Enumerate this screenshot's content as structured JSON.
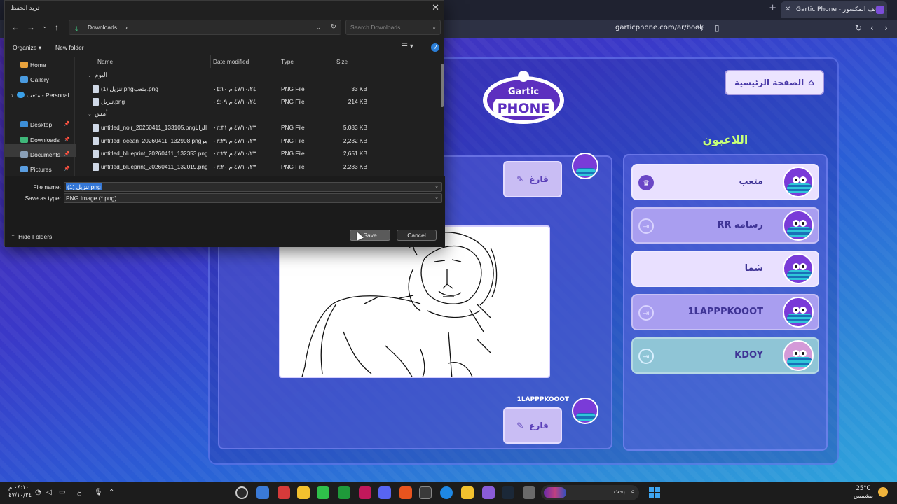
{
  "browser": {
    "tab_title": "Gartic Phone - لعبة الهاتف المكسور",
    "url": "garticphone.com/ar/book"
  },
  "game": {
    "home_button": "الصفحة الرئيسية",
    "players_title": "اللاعبون",
    "players": [
      {
        "name": "متعب",
        "badge": "crown-icon",
        "highlight": true
      },
      {
        "name": "رسامه RR",
        "badge": "exit-icon",
        "highlight": false
      },
      {
        "name": "شما",
        "badge": "",
        "highlight": true
      },
      {
        "name": "1LAPPPKOOOT",
        "badge": "exit-icon",
        "highlight": false
      },
      {
        "name": "KDOY",
        "badge": "exit-icon",
        "highlight": false
      }
    ],
    "empty_label": "فارغ",
    "author_label": "1LAPPPKOOOT",
    "colors": {
      "accent": "#7a3bd8",
      "title_green": "#c6ff7a"
    }
  },
  "dialog": {
    "title": "تريد الحفظ",
    "location": "Downloads",
    "search_placeholder": "Search Downloads",
    "organize": "Organize",
    "new_folder": "New folder",
    "nav": [
      {
        "label": "Home",
        "icon": "home-icon"
      },
      {
        "label": "Gallery",
        "icon": "gallery-icon"
      },
      {
        "label": "متعب - Personal",
        "icon": "onedrive-icon"
      },
      {
        "label": "Desktop",
        "icon": "desktop-icon"
      },
      {
        "label": "Downloads",
        "icon": "downloads-icon"
      },
      {
        "label": "Documents",
        "icon": "documents-icon"
      },
      {
        "label": "Pictures",
        "icon": "pictures-icon"
      }
    ],
    "columns": {
      "name": "Name",
      "date": "Date modified",
      "type": "Type",
      "size": "Size"
    },
    "groups": [
      {
        "label": "اليوم",
        "files": [
          {
            "name": "تنزيل (1).pngمتعب.png",
            "date": "٤٧/١٠/٢٤ م ٠٤:١٠",
            "type": "PNG File",
            "size": "33 KB"
          },
          {
            "name": "تنزيل.png",
            "date": "٤٧/١٠/٢٤ م ٠٤:٠٩",
            "type": "PNG File",
            "size": "214 KB"
          }
        ]
      },
      {
        "label": "أمس",
        "files": [
          {
            "name": "untitled_noir_20260411_133105.pngالرايا...",
            "date": "٤٧/١٠/٢٣ م ٠٢:٣١",
            "type": "PNG File",
            "size": "5,083 KB"
          },
          {
            "name": "untitled_ocean_20260411_132908.pngالمر...",
            "date": "٤٧/١٠/٢٣ م ٠٢:٢٩",
            "type": "PNG File",
            "size": "2,232 KB"
          },
          {
            "name": "untitled_blueprint_20260411_132353.png...",
            "date": "٤٧/١٠/٢٣ م ٠٢:٢٣",
            "type": "PNG File",
            "size": "2,651 KB"
          },
          {
            "name": "untitled_blueprint_20260411_132019.png...",
            "date": "٤٧/١٠/٢٣ م ٠٢:٢٠",
            "type": "PNG File",
            "size": "2,283 KB"
          }
        ]
      }
    ],
    "file_name_label": "File name:",
    "file_name_value": "تنزيل (1).png",
    "save_type_label": "Save as type:",
    "save_type_value": "PNG Image (*.png)",
    "hide_folders": "Hide Folders",
    "save": "Save",
    "cancel": "Cancel"
  },
  "taskbar": {
    "time": "٠٤:١٠ م",
    "date": "٤٧/١٠/٢٤",
    "lang": "ع",
    "search_text": "بحث",
    "temperature": "25°C",
    "weather": "مشمس"
  }
}
